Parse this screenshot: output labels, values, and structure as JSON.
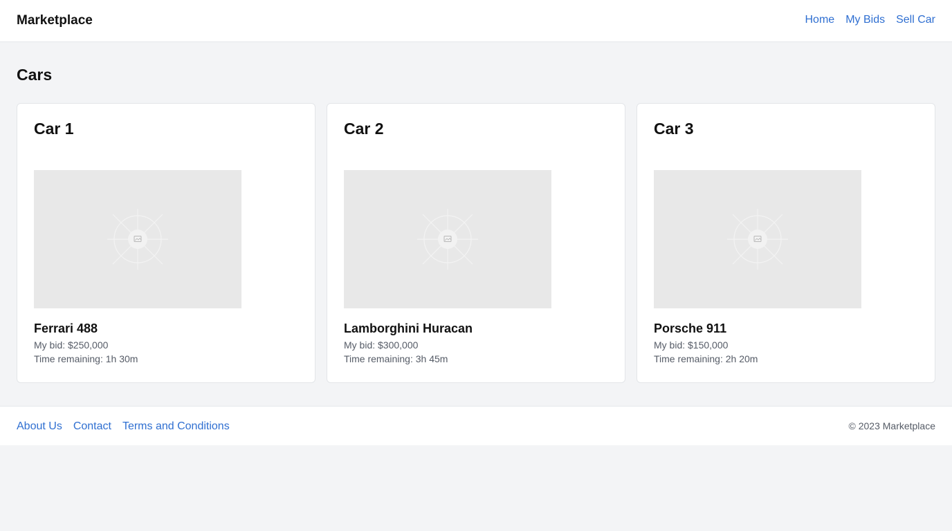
{
  "header": {
    "brand": "Marketplace",
    "nav": [
      "Home",
      "My Bids",
      "Sell Car"
    ]
  },
  "main": {
    "title": "Cars",
    "cards": [
      {
        "title": "Car 1",
        "name": "Ferrari 488",
        "bid": "My bid: $250,000",
        "time": "Time remaining: 1h 30m",
        "image_icon": "image-placeholder-icon"
      },
      {
        "title": "Car 2",
        "name": "Lamborghini Huracan",
        "bid": "My bid: $300,000",
        "time": "Time remaining: 3h 45m",
        "image_icon": "image-placeholder-icon"
      },
      {
        "title": "Car 3",
        "name": "Porsche 911",
        "bid": "My bid: $150,000",
        "time": "Time remaining: 2h 20m",
        "image_icon": "image-placeholder-icon"
      }
    ]
  },
  "footer": {
    "links": [
      "About Us",
      "Contact",
      "Terms and Conditions"
    ],
    "copyright": "© 2023 Marketplace"
  },
  "colors": {
    "background": "#f3f4f6",
    "surface": "#ffffff",
    "link": "#2f6fd1",
    "muted_text": "#555b66",
    "image_placeholder": "#e8e8e8"
  }
}
